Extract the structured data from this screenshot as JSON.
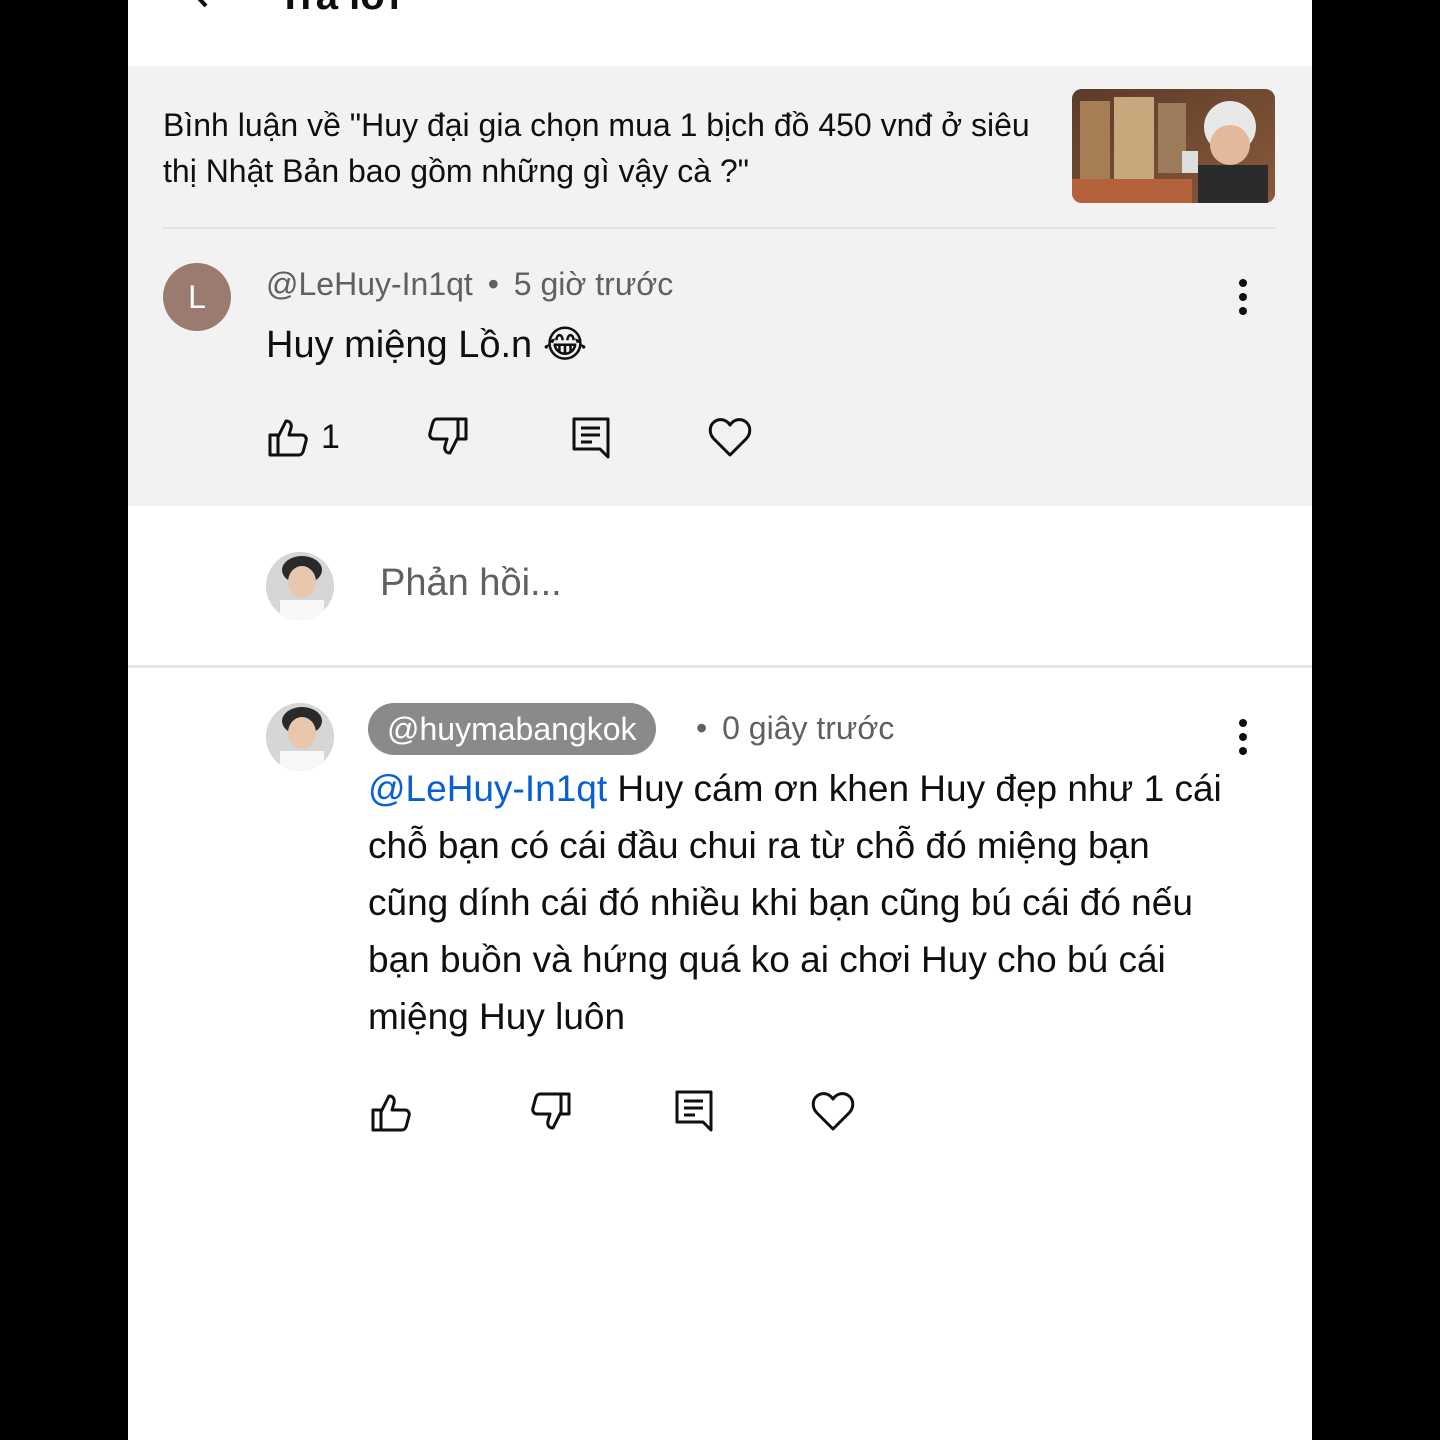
{
  "appbar": {
    "title": "Trả lời"
  },
  "video": {
    "comment_context": "Bình luận về \"Huy đại gia chọn mua 1 bịch đồ 450 vnđ ở siêu thị Nhật Bản bao gồm những gì vậy cà ?\""
  },
  "parent_comment": {
    "avatar_letter": "L",
    "author": "@LeHuy-In1qt",
    "separator": "•",
    "time": "5 giờ trước",
    "text": "Huy miệng Lồ.n 😂",
    "like_count": "1"
  },
  "reply_input": {
    "placeholder": "Phản hồi..."
  },
  "reply": {
    "author": "@huymabangkok",
    "separator": "•",
    "time": "0 giây trước",
    "mention": "@LeHuy-In1qt",
    "text": " Huy cám ơn khen Huy đẹp như 1 cái chỗ bạn có cái đầu chui ra từ chỗ đó miệng bạn cũng dính cái đó nhiều khi bạn cũng bú cái đó nếu bạn buồn và hứng quá ko ai chơi Huy cho bú cái miệng Huy luôn"
  },
  "icons": [
    "back-icon",
    "playlist-icon",
    "search-icon",
    "more-icon",
    "like-icon",
    "dislike-icon",
    "reply-icon",
    "heart-icon"
  ],
  "colors": {
    "background": "#000000",
    "panel": "#ffffff",
    "highlight": "#f2f2f2",
    "mention": "#065fd4",
    "chip": "#8a8a8a",
    "avatar": "#9b7b6f"
  }
}
